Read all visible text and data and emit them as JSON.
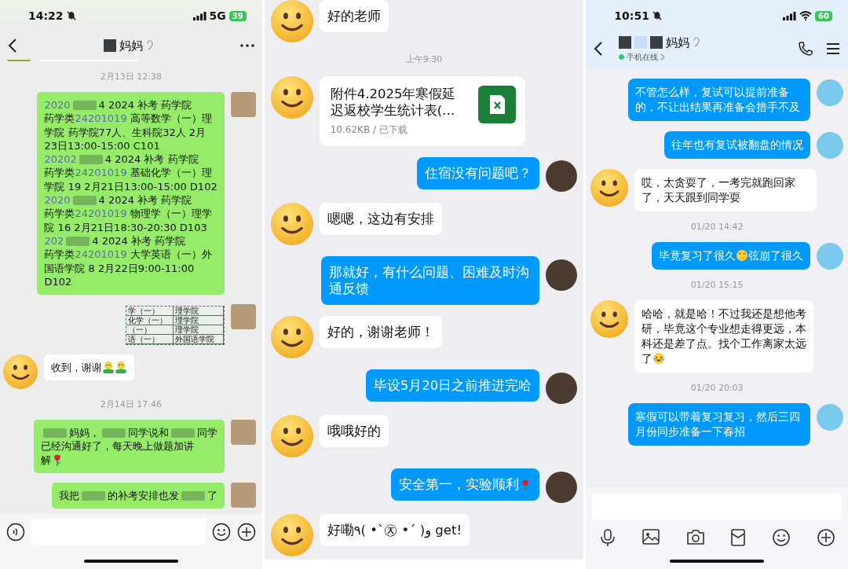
{
  "panels": [
    {
      "kind": "wechat",
      "status": {
        "time": "14:22",
        "network": "5G",
        "battery": "39"
      },
      "header": {
        "title": "妈妈"
      },
      "messages": [
        {
          "kind": "cut",
          "outgoing": false
        },
        {
          "kind": "time",
          "text": "2月13日 12:38"
        },
        {
          "kind": "rich",
          "outgoing": true,
          "lines": [
            [
              {
                "kind": "number",
                "text": "2020"
              },
              {
                "kind": "redacted"
              },
              {
                "kind": "text",
                "text": "4 2024 补考 药学院"
              }
            ],
            [
              {
                "kind": "text",
                "text": "药学类"
              },
              {
                "kind": "number",
                "text": "24201019"
              },
              {
                "kind": "text",
                "text": " 高等数学（一）理"
              }
            ],
            [
              {
                "kind": "text",
                "text": "学院 药学院77人、生科院32人 2月"
              }
            ],
            [
              {
                "kind": "text",
                "text": "23日13:00-15:00 C101"
              }
            ],
            [
              {
                "kind": "number",
                "text": "20202"
              },
              {
                "kind": "redacted"
              },
              {
                "kind": "text",
                "text": "4 2024 补考 药学院"
              }
            ],
            [
              {
                "kind": "text",
                "text": "药学类"
              },
              {
                "kind": "number",
                "text": "24201019"
              },
              {
                "kind": "text",
                "text": " 基础化学（一）理"
              }
            ],
            [
              {
                "kind": "text",
                "text": "学院 19 2月21日13:00-15:00 D102"
              }
            ],
            [
              {
                "kind": "number",
                "text": "2020"
              },
              {
                "kind": "redacted"
              },
              {
                "kind": "text",
                "text": "4 2024 补考 药学院"
              }
            ],
            [
              {
                "kind": "text",
                "text": "药学类"
              },
              {
                "kind": "number",
                "text": "24201019"
              },
              {
                "kind": "text",
                "text": " 物理学（一）理学"
              }
            ],
            [
              {
                "kind": "text",
                "text": "院 16 2月21日18:30-20:30 D103"
              }
            ],
            [
              {
                "kind": "number",
                "text": "202"
              },
              {
                "kind": "redacted"
              },
              {
                "kind": "text",
                "text": "4 2024 补考 药学院"
              }
            ],
            [
              {
                "kind": "text",
                "text": "药学类"
              },
              {
                "kind": "number",
                "text": "24201019"
              },
              {
                "kind": "text",
                "text": " 大学英语（一）外"
              }
            ],
            [
              {
                "kind": "text",
                "text": "国语学院 8 2月22日9:00-11:00"
              }
            ],
            [
              {
                "kind": "text",
                "text": "D102"
              }
            ]
          ]
        },
        {
          "kind": "image",
          "outgoing": true,
          "rows": [
            [
              "学（一）",
              "理学院"
            ],
            [
              "化学（一）",
              "理学院"
            ],
            [
              "（一）",
              "理学院"
            ],
            [
              "语（一）",
              "外国语学院"
            ]
          ]
        },
        {
          "kind": "rich",
          "outgoing": false,
          "lines": [
            [
              {
                "kind": "text",
                "text": "收到，谢谢"
              },
              {
                "kind": "hug"
              },
              {
                "kind": "hug"
              }
            ]
          ]
        },
        {
          "kind": "time",
          "text": "2月14日 17:46"
        },
        {
          "kind": "rich",
          "outgoing": true,
          "lines": [
            [
              {
                "kind": "redacted"
              },
              {
                "kind": "text",
                "text": "妈妈，"
              },
              {
                "kind": "redacted"
              },
              {
                "kind": "text",
                "text": "同学说和"
              },
              {
                "kind": "redacted"
              },
              {
                "kind": "text",
                "text": "同学"
              }
            ],
            [
              {
                "kind": "text",
                "text": "已经沟通好了，每天晚上做题加讲"
              }
            ],
            [
              {
                "kind": "text",
                "text": "解"
              },
              {
                "kind": "rose"
              }
            ]
          ]
        },
        {
          "kind": "rich",
          "outgoing": true,
          "lines": [
            [
              {
                "kind": "text",
                "text": "我把"
              },
              {
                "kind": "redacted"
              },
              {
                "kind": "text",
                "text": "的补考安排也发"
              },
              {
                "kind": "redacted"
              },
              {
                "kind": "text",
                "text": "了"
              }
            ]
          ]
        }
      ]
    },
    {
      "kind": "plain",
      "messages": [
        {
          "kind": "text",
          "outgoing": false,
          "text": "好的老师"
        },
        {
          "kind": "time",
          "text": "上午9:30"
        },
        {
          "kind": "file",
          "outgoing": false,
          "name": "附件4.2025年寒假延迟返校学生统计表(…",
          "meta": "10.62KB / 已下载"
        },
        {
          "kind": "text",
          "outgoing": true,
          "text": "住宿没有问题吧？"
        },
        {
          "kind": "text",
          "outgoing": false,
          "text": "嗯嗯，这边有安排"
        },
        {
          "kind": "text",
          "outgoing": true,
          "text": "那就好，有什么问题、困难及时沟通反馈"
        },
        {
          "kind": "text",
          "outgoing": false,
          "text": "好的，谢谢老师！"
        },
        {
          "kind": "text",
          "outgoing": true,
          "text": "毕设5月20日之前推进完哈"
        },
        {
          "kind": "text",
          "outgoing": false,
          "text": "哦哦好的"
        },
        {
          "kind": "rich",
          "outgoing": true,
          "lines": [
            [
              {
                "kind": "text",
                "text": "安全第一，实验顺利"
              },
              {
                "kind": "rose"
              }
            ]
          ]
        },
        {
          "kind": "text",
          "outgoing": false,
          "text": "好嘞٩( •`㉨ •´ )و get!"
        }
      ]
    },
    {
      "kind": "qq",
      "status": {
        "time": "10:51",
        "battery": "60"
      },
      "header": {
        "title": "妈妈",
        "presence": "手机在线"
      },
      "messages": [
        {
          "kind": "text",
          "outgoing": true,
          "text": "不管怎么样，复试可以提前准备的，不让出结果再准备会措手不及"
        },
        {
          "kind": "text",
          "outgoing": true,
          "text": "往年也有复试被翻盘的情况"
        },
        {
          "kind": "text",
          "outgoing": false,
          "text": "哎，太贪耍了，一考完就跑回家了，天天跟到同学耍"
        },
        {
          "kind": "time",
          "text": "01/20 14:42"
        },
        {
          "kind": "rich",
          "outgoing": true,
          "lines": [
            [
              {
                "kind": "text",
                "text": "毕竟复习了很久"
              },
              {
                "kind": "giggle"
              },
              {
                "kind": "text",
                "text": "弦崩了很久"
              }
            ]
          ]
        },
        {
          "kind": "time",
          "text": "01/20 15:15"
        },
        {
          "kind": "rich",
          "outgoing": false,
          "lines": [
            [
              {
                "kind": "text",
                "text": "哈哈，就是哈！不过我还是想他考"
              }
            ],
            [
              {
                "kind": "text",
                "text": "研，毕竟这个专业想走得更远，本"
              }
            ],
            [
              {
                "kind": "text",
                "text": "科还是差了点。找个工作离家太远"
              }
            ],
            [
              {
                "kind": "text",
                "text": "了"
              },
              {
                "kind": "laugh"
              }
            ]
          ]
        },
        {
          "kind": "time",
          "text": "01/20 20:03"
        },
        {
          "kind": "text",
          "outgoing": true,
          "text": "寒假可以带着复习复习，然后三四月份同步准备一下春招"
        }
      ]
    }
  ]
}
